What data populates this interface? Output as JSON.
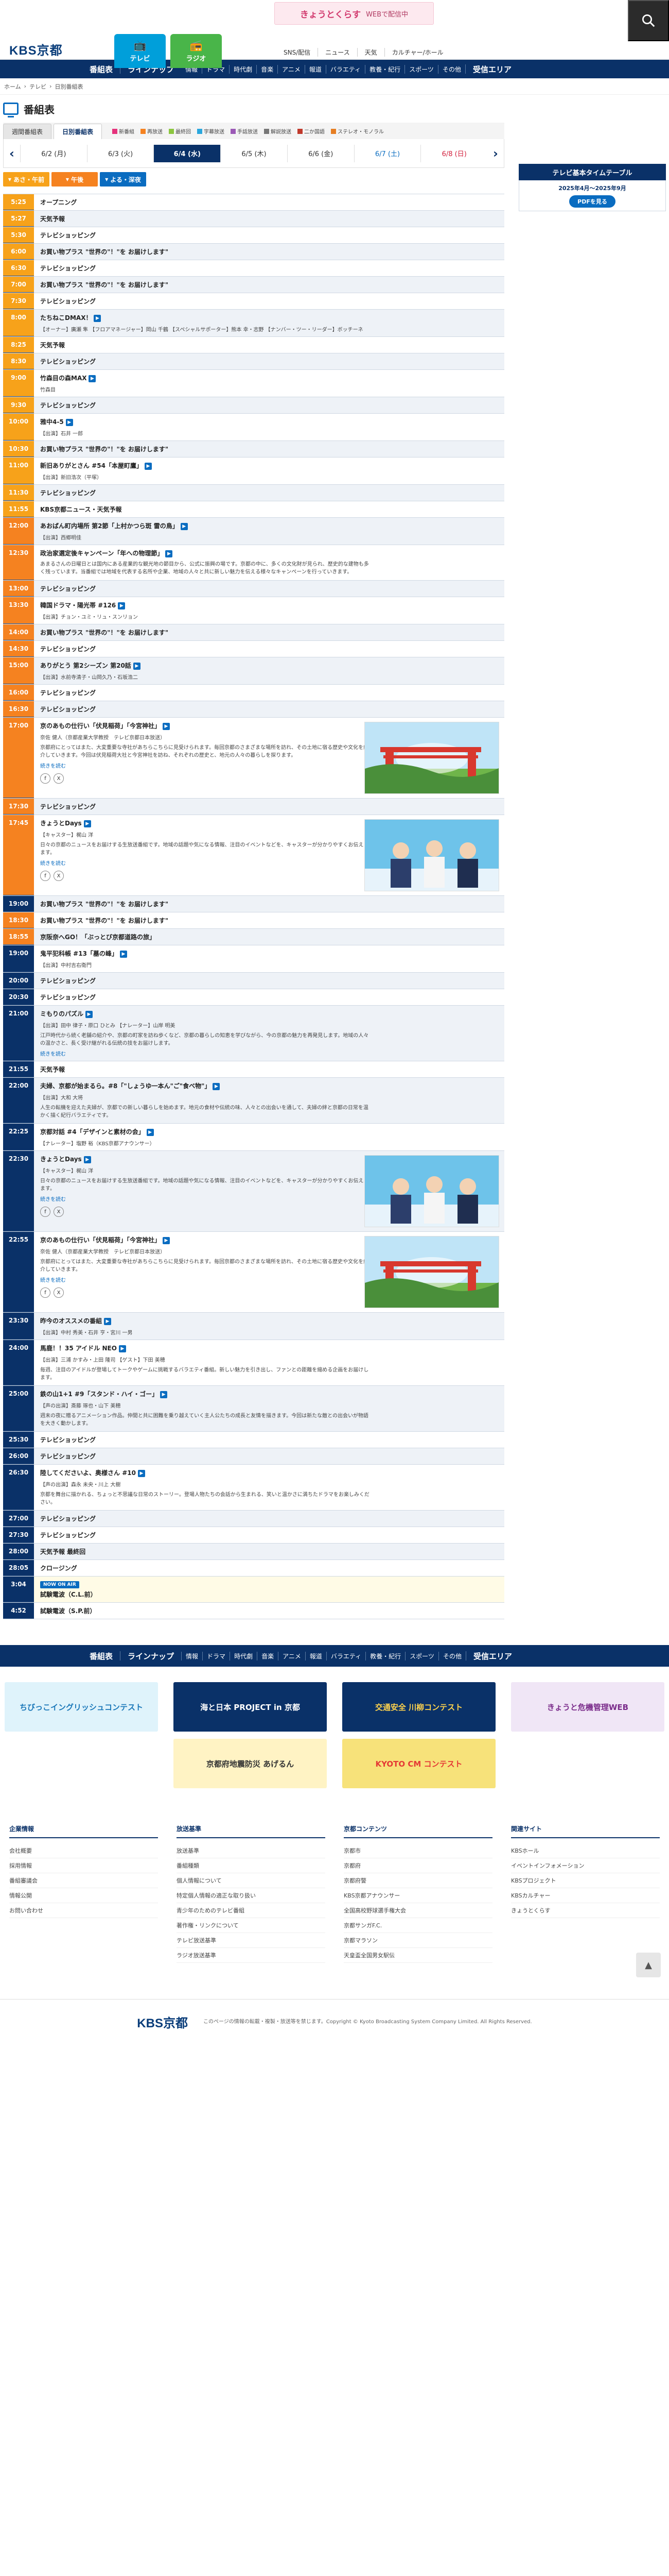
{
  "header": {
    "logo": "KBS京都",
    "banner_title": "きょうとくらす",
    "banner_sub": "WEBで配信中",
    "tabs": [
      {
        "label": "テレビ",
        "icon": "tv-icon"
      },
      {
        "label": "ラジオ",
        "icon": "radio-icon"
      }
    ],
    "links": [
      "SNS/配信",
      "ニュース",
      "天気",
      "カルチャー/ホール"
    ]
  },
  "gnav": {
    "big_left": [
      "番組表",
      "ラインナップ"
    ],
    "genres": [
      "情報",
      "ドラマ",
      "時代劇",
      "音楽",
      "アニメ",
      "報道",
      "バラエティ",
      "教養・紀行",
      "スポーツ",
      "その他"
    ],
    "big_right": "受信エリア"
  },
  "breadcrumb": [
    "ホーム",
    "テレビ",
    "日別番組表"
  ],
  "page_title": "番組表",
  "tabs": [
    "週間番組表",
    "日別番組表"
  ],
  "legend": [
    {
      "label": "新番組",
      "color": "#e5337c"
    },
    {
      "label": "再放送",
      "color": "#f58220"
    },
    {
      "label": "最終回",
      "color": "#8cc63f"
    },
    {
      "label": "字幕放送",
      "color": "#2aa7dd"
    },
    {
      "label": "手話放送",
      "color": "#9b59b6"
    },
    {
      "label": "解説放送",
      "color": "#777777"
    },
    {
      "label": "二か国語",
      "color": "#c0392b"
    },
    {
      "label": "ステレオ・モノラル",
      "color": "#e67e22"
    }
  ],
  "dates": [
    "6/2 (月)",
    "6/3 (火)",
    "6/4 (水)",
    "6/5 (木)",
    "6/6 (金)",
    "6/7 (土)",
    "6/8 (日)"
  ],
  "zones": [
    "あさ・午前",
    "午後",
    "よる・深夜"
  ],
  "side": {
    "title": "テレビ基本タイムテーブル",
    "period": "2025年4月〜2025年9月",
    "pdf": "PDFを見る"
  },
  "programs": [
    {
      "time": "5:25",
      "title": "オープニング"
    },
    {
      "time": "5:27",
      "title": "天気予報"
    },
    {
      "time": "5:30",
      "title": "テレビショッピング"
    },
    {
      "time": "6:00",
      "title": "お買い物プラス \"世界の\"！\"を お届けします\""
    },
    {
      "time": "6:30",
      "title": "テレビショッピング"
    },
    {
      "time": "7:00",
      "title": "お買い物プラス \"世界の\"！\"を お届けします\""
    },
    {
      "time": "7:30",
      "title": "テレビショッピング"
    },
    {
      "time": "8:00",
      "title": "たちねこDMAX！",
      "cast": "【オーナー】廣瀬 隼 【フロアマネージャー】岡山 千鶴 【スペシャルサポーター】熊本 幸・志野 【ナンバー・ツー・リーダー】ボッチーネ"
    },
    {
      "time": "8:25",
      "title": "天気予報"
    },
    {
      "time": "8:30",
      "title": "テレビショッピング"
    },
    {
      "time": "9:00",
      "title": "竹森目の森MAX",
      "cast": "竹森目"
    },
    {
      "time": "9:30",
      "title": "テレビショッピング"
    },
    {
      "time": "10:00",
      "title": "雅中4-5",
      "cast": "【出演】石井 一郎"
    },
    {
      "time": "10:30",
      "title": "お買い物プラス \"世界の\"！\"を お届けします\""
    },
    {
      "time": "11:00",
      "title": "新旧ありがとさん #54「本屋町鷹」",
      "cast": "【出演】新旧浩次（平塚）"
    },
    {
      "time": "11:30",
      "title": "テレビショッピング"
    },
    {
      "time": "11:55",
      "title": "KBS京都ニュース・天気予報"
    },
    {
      "time": "12:00",
      "title": "あおばん町内場所 第2節「上村かつら斑 雷の鳥」",
      "cast": "【出演】西郷明佳"
    },
    {
      "time": "12:30",
      "title": "政治家選定後キャンペーン「年への物理節」",
      "desc": "あまるさんの日曜日とは国内にある産業的な観光地の節目から、公式に振興の場です。京都の中に、多くの文化財が見られ、歴史的な建物も多く残っています。当番組では地域を代表する名所や企業、地域の人々と共に新しい魅力を伝える様々なキャンペーンを行っていきます。"
    },
    {
      "time": "13:00",
      "title": "テレビショッピング"
    },
    {
      "time": "13:30",
      "title": "韓国ドラマ・陽光帯 #126",
      "cast": "【出演】チョン・ユミ・リュ・スンリョン"
    },
    {
      "time": "14:00",
      "title": "お買い物プラス \"世界の\"！\"を お届けします\""
    },
    {
      "time": "14:30",
      "title": "テレビショッピング"
    },
    {
      "time": "15:00",
      "title": "ありがとう 第2シーズン 第20話",
      "cast": "【出演】水前寺清子・山岡久乃・石坂浩二"
    },
    {
      "time": "16:00",
      "title": "テレビショッピング"
    },
    {
      "time": "16:30",
      "title": "テレビショッピング"
    },
    {
      "time": "17:00",
      "title": "京のあもの仕行い「伏見稲荷」「今宮神社」",
      "cast": "奈佐 健人（京都産業大学教授　テレビ京都日本放送）",
      "desc": "京都府にとってはまた、大変重要な寺社があちらこちらに見受けられます。毎回京都のさまざまな場所を訪れ、その土地に宿る歴史や文化を紹介していきます。今回は伏見稲荷大社と今宮神社を訪ね、それぞれの歴史と、地元の人々の暮らしを探ります。",
      "more": "続きを読む",
      "thumb": "shrine"
    },
    {
      "time": "17:30",
      "title": "テレビショッピング"
    },
    {
      "time": "17:45",
      "title": "きょうとDays",
      "cast": "【キャスター】梶山 洋",
      "desc": "日々の京都のニュースをお届けする生放送番組です。地域の話題や気になる情報、注目のイベントなどを、キャスターが分かりやすくお伝えします。",
      "more": "続きを読む",
      "thumb": "studio"
    },
    {
      "time": "19:00",
      "title": "お買い物プラス \"世界の\"！\"を お届けします\""
    },
    {
      "time": "18:30",
      "title": "お買い物プラス \"世界の\"！\"を お届けします\""
    },
    {
      "time": "18:55",
      "title": "京阪奈へGO！「ぶっとび京都道路の旅」"
    },
    {
      "time": "19:00",
      "title": "鬼平犯科帳 #13「墓の峰」",
      "cast": "【出演】中村吉右衛門"
    },
    {
      "time": "20:00",
      "title": "テレビショッピング"
    },
    {
      "time": "20:30",
      "title": "テレビショッピング"
    },
    {
      "time": "21:00",
      "title": "ミもりのパズル",
      "cast": "【出演】田中 律子・原口 ひとみ 【ナレーター】山岸 明美",
      "desc": "江戸時代から続く老舗の紹介や、京都の町家を訪ね歩くなど、京都の暮らしの知恵を学びながら、今の京都の魅力を再発見します。地域の人々の温かさと、長く受け継がれる伝統の技をお届けします。",
      "more": "続きを読む"
    },
    {
      "time": "21:55",
      "title": "天気予報"
    },
    {
      "time": "22:00",
      "title": "夫婦、京都が始まるら。#8「\"しょうゆ一本ん\"ご\"食べ物\"」",
      "cast": "【出演】大和 大将",
      "desc": "人生の転機を迎えた夫婦が、京都での新しい暮らしを始めます。地元の食材や伝統の味、人々との出会いを通して、夫婦の絆と京都の日常を温かく描く紀行バラエティです。"
    },
    {
      "time": "22:25",
      "title": "京都対話 #4「デザインと素材の会」",
      "cast": "【ナレーター】塩野 裕（KBS京都アナウンサー）"
    },
    {
      "time": "22:30",
      "title": "きょうとDays",
      "cast": "【キャスター】梶山 洋",
      "desc": "日々の京都のニュースをお届けする生放送番組です。地域の話題や気になる情報、注目のイベントなどを、キャスターが分かりやすくお伝えします。",
      "more": "続きを読む",
      "thumb": "studio"
    },
    {
      "time": "22:55",
      "title": "京のあもの仕行い「伏見稲荷」「今宮神社」",
      "cast": "奈佐 健人（京都産業大学教授　テレビ京都日本放送）",
      "desc": "京都府にとってはまた、大変重要な寺社があちらこちらに見受けられます。毎回京都のさまざまな場所を訪れ、その土地に宿る歴史や文化を紹介していきます。",
      "more": "続きを読む",
      "thumb": "shrine"
    },
    {
      "time": "23:30",
      "title": "昨今のオススメの番組",
      "cast": "【出演】中村 秀美・石井 亨・宮川 一男"
    },
    {
      "time": "24:00",
      "title": "馬鹿！！35 アイドル NEO",
      "cast": "【出演】三浦 かすみ・上田 隆司 【ゲスト】下田 美穂",
      "desc": "毎週、注目のアイドルが登場してトークやゲームに挑戦するバラエティ番組。新しい魅力を引き出し、ファンとの距離を縮める企画をお届けします。"
    },
    {
      "time": "25:00",
      "title": "鉄の山1+1 #9「スタンド・ハイ・ゴー」",
      "cast": "【声の出演】斎藤 琢也・山下 美穂",
      "desc": "週末の夜に贈るアニメーション作品。仲間と共に困難を乗り越えていく主人公たちの成長と友情を描きます。今回は新たな敵との出会いが物語を大きく動かします。"
    },
    {
      "time": "25:30",
      "title": "テレビショッピング"
    },
    {
      "time": "26:00",
      "title": "テレビショッピング"
    },
    {
      "time": "26:30",
      "title": "陸してくださいよ、奥様さん #10",
      "cast": "【声の出演】森永 未央・川上 大樹",
      "desc": "京都を舞台に描かれる、ちょっと不思議な日常のストーリー。登場人物たちの会話から生まれる、笑いと温かさに満ちたドラマをお楽しみください。"
    },
    {
      "time": "27:00",
      "title": "テレビショッピング"
    },
    {
      "time": "27:30",
      "title": "テレビショッピング"
    },
    {
      "time": "28:00",
      "title": "天気予報 最終回"
    },
    {
      "time": "28:05",
      "title": "クロージング"
    },
    {
      "time": "3:04",
      "title": "試験電波（C.L.前）",
      "now": "NOW ON AIR"
    },
    {
      "time": "4:52",
      "title": "試験電波（S.P.前）"
    }
  ],
  "banners": [
    {
      "label": "ちびっこイングリッシュコンテスト",
      "bg": "#dff3fb",
      "fg": "#1b78b9"
    },
    {
      "label": "海と日本 PROJECT in 京都",
      "bg": "#0a3168",
      "fg": "#ffffff"
    },
    {
      "label": "交通安全 川柳コンテスト",
      "bg": "#0a3168",
      "fg": "#ffd34d"
    },
    {
      "label": "きょうと危機管理WEB",
      "bg": "#f0e6f6",
      "fg": "#7b2d8b"
    },
    {
      "label": "京都府地震防災 あげるん",
      "bg": "#fff3c4",
      "fg": "#333333"
    },
    {
      "label": "KYOTO CM コンテスト",
      "bg": "#f7e27a",
      "fg": "#e53935"
    }
  ],
  "footer": {
    "columns": [
      {
        "title": "企業情報",
        "items": [
          "会社概要",
          "採用情報",
          "番組審議会",
          "情報公開",
          "お問い合わせ"
        ]
      },
      {
        "title": "放送基準",
        "items": [
          "放送基準",
          "番組種類",
          "個人情報について",
          "特定個人情報の適正な取り扱い",
          "青少年のためのテレビ番組",
          "著作権・リンクについて",
          "テレビ放送基準",
          "ラジオ放送基準"
        ]
      },
      {
        "title": "京都コンテンツ",
        "items": [
          "京都市",
          "京都府",
          "京都府警",
          "KBS京都アナウンサー",
          "全国高校野球選手権大会",
          "京都サンガF.C.",
          "京都マラソン",
          "天皇盃全国男女駅伝"
        ]
      },
      {
        "title": "関連サイト",
        "items": [
          "KBSホール",
          "イベントインフォメーション",
          "KBSプロジェクト",
          "KBSカルチャー",
          "きょうとくらす"
        ]
      }
    ],
    "copyright": "このページの情報の転載・複製・放送等を禁じます。Copyright © Kyoto Broadcasting System Company Limited. All Rights Reserved."
  }
}
